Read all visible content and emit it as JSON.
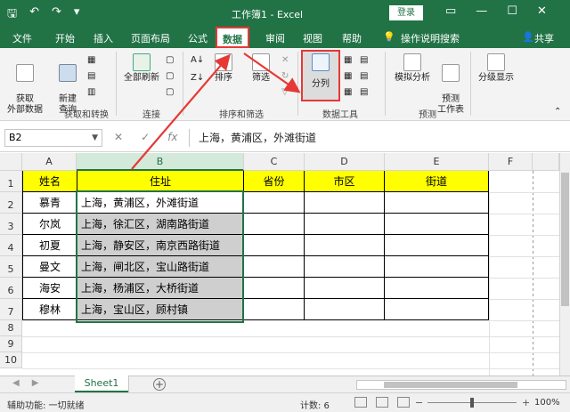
{
  "titlebar": {
    "title": "工作簿1 - Excel",
    "login_label": "登录"
  },
  "ribbon_tabs": [
    {
      "label": "文件",
      "active": false
    },
    {
      "label": "开始",
      "active": false
    },
    {
      "label": "插入",
      "active": false
    },
    {
      "label": "页面布局",
      "active": false
    },
    {
      "label": "公式",
      "active": false
    },
    {
      "label": "数据",
      "active": true
    },
    {
      "label": "审阅",
      "active": false
    },
    {
      "label": "视图",
      "active": false
    },
    {
      "label": "帮助",
      "active": false
    },
    {
      "label": "操作说明搜索",
      "active": false
    },
    {
      "label": "共享",
      "active": false
    }
  ],
  "ribbon": {
    "get_data": "获取\n外部数据",
    "new_query": "新建\n查询",
    "group_get_transform": "获取和转换",
    "refresh_all": "全部刷新",
    "group_connections": "连接",
    "sort": "排序",
    "filter": "筛选",
    "group_sort_filter": "排序和筛选",
    "text_to_columns": "分列",
    "group_data_tools": "数据工具",
    "what_if": "模拟分析",
    "forecast_sheet": "预测\n工作表",
    "group_forecast": "预测",
    "outline": "分级显示"
  },
  "formula_bar": {
    "name_box": "B2",
    "formula": "上海，黄浦区，外滩街道"
  },
  "columns": [
    "A",
    "B",
    "C",
    "D",
    "E",
    "F"
  ],
  "rows": [
    "1",
    "2",
    "3",
    "4",
    "5",
    "6",
    "7",
    "8",
    "9",
    "10"
  ],
  "table": {
    "headers": [
      "姓名",
      "住址",
      "省份",
      "市区",
      "街道"
    ],
    "rows": [
      {
        "name": "慕青",
        "address": "上海，黄浦区，外滩街道"
      },
      {
        "name": "尔岚",
        "address": "上海，徐汇区，湖南路街道"
      },
      {
        "name": "初夏",
        "address": "上海，静安区，南京西路街道"
      },
      {
        "name": "曼文",
        "address": "上海，闸北区，宝山路街道"
      },
      {
        "name": "海安",
        "address": "上海，杨浦区，大桥街道"
      },
      {
        "name": "穆林",
        "address": "上海，宝山区，顾村镇"
      }
    ]
  },
  "sheet_tabs": [
    {
      "label": "Sheet1",
      "active": true
    }
  ],
  "statusbar": {
    "accessibility": "辅助功能: 一切就绪",
    "count": "计数: 6",
    "zoom": "100%"
  },
  "colors": {
    "excel_green": "#217346",
    "header_fill": "#ffff00",
    "selection_fill": "#cfcfcf",
    "annotation_red": "#e53935"
  }
}
